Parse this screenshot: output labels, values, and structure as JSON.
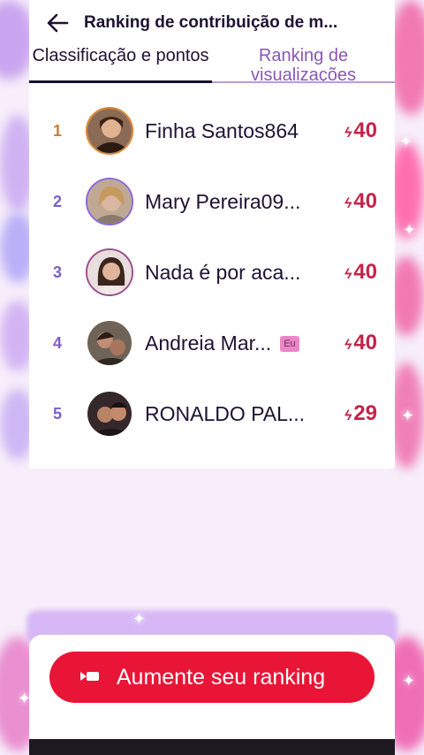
{
  "header": {
    "title": "Ranking de contribuição de m..."
  },
  "tabs": [
    {
      "label": "Classificação e pontos",
      "active": true
    },
    {
      "label": "Ranking de visualizações",
      "active": false
    }
  ],
  "ranking": [
    {
      "rank": "1",
      "name": "Finha Santos864",
      "points": "40",
      "is_me": false
    },
    {
      "rank": "2",
      "name": "Mary Pereira09...",
      "points": "40",
      "is_me": false
    },
    {
      "rank": "3",
      "name": "Nada é por aca...",
      "points": "40",
      "is_me": false
    },
    {
      "rank": "4",
      "name": "Andreia Mar...",
      "points": "40",
      "is_me": true
    },
    {
      "rank": "5",
      "name": "RONALDO PAL...",
      "points": "29",
      "is_me": false
    }
  ],
  "me_badge": "Eu",
  "cta": {
    "label": "Aumente seu ranking"
  },
  "colors": {
    "accent_red": "#e91536",
    "points_red": "#c42349",
    "rank_gold": "#c97d3a",
    "rank_purple": "#7b5fc9"
  },
  "icons": {
    "back": "arrow-left",
    "points": "lightning-bolt",
    "cta": "video-camera"
  }
}
